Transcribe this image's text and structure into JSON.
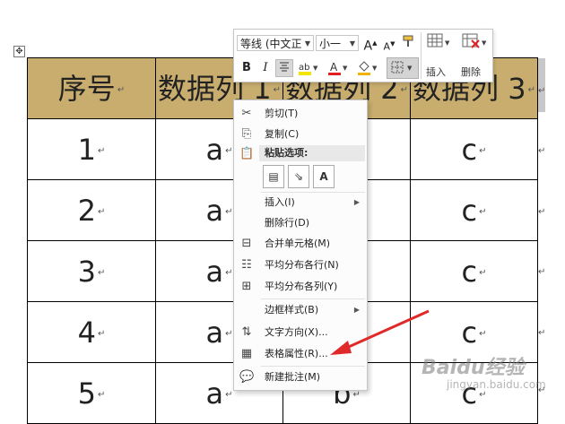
{
  "table": {
    "header": [
      "序号",
      "数据列 1",
      "数据列 2",
      "数据列 3"
    ],
    "rows": [
      [
        "1",
        "a",
        "",
        "c"
      ],
      [
        "2",
        "a",
        "",
        "c"
      ],
      [
        "3",
        "a",
        "",
        "c"
      ],
      [
        "4",
        "a",
        "",
        "c"
      ],
      [
        "5",
        "a",
        "b",
        "c"
      ]
    ],
    "paragraph_mark": "↵",
    "header_color": "#c8ad6e"
  },
  "mini_toolbar": {
    "font_name": "等线 (中文正",
    "font_size": "小一",
    "grow_font": "A",
    "shrink_font": "A",
    "bold": "B",
    "italic": "I",
    "font_color_letter": "A",
    "insert_label": "插入",
    "delete_label": "删除",
    "font_color": "#e02020",
    "highlight_color": "#f2e600"
  },
  "context_menu": {
    "cut": "剪切(T)",
    "copy": "复制(C)",
    "paste_options": "粘贴选项:",
    "insert": "插入(I)",
    "delete_row": "删除行(D)",
    "merge_cells": "合并单元格(M)",
    "distribute_rows": "平均分布各行(N)",
    "distribute_cols": "平均分布各列(Y)",
    "border_styles": "边框样式(B)",
    "text_direction": "文字方向(X)...",
    "table_properties": "表格属性(R)...",
    "new_comment": "新建批注(M)"
  },
  "watermark": {
    "logo": "Baidu经验",
    "url": "jingyan.baidu.com"
  },
  "move_handle": "✥",
  "arrow_color": "#e02a2a"
}
